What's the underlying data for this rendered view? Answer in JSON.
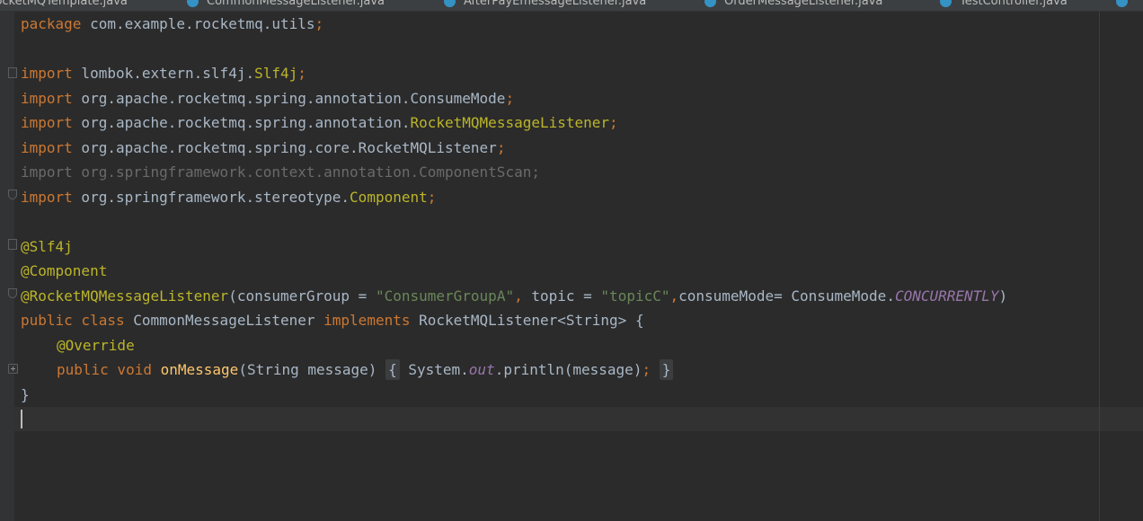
{
  "tabs": [
    {
      "label": "RocketMQTemplate.java"
    },
    {
      "label": "CommonMessageListener.java"
    },
    {
      "label": "AfterPayEmessageListener.java"
    },
    {
      "label": "OrderMessageListener.java"
    },
    {
      "label": "TestController.java"
    }
  ],
  "code": {
    "package_kw": "package",
    "package_name": " com.example.rocketmq.utils",
    "semicolon": ";",
    "import_kw": "import",
    "imports": [
      {
        "path": " lombok.extern.slf4j.",
        "cls": "Slf4j"
      },
      {
        "path": " org.apache.rocketmq.spring.annotation.ConsumeMode",
        "cls": ""
      },
      {
        "path": " org.apache.rocketmq.spring.annotation.",
        "cls": "RocketMQMessageListener"
      },
      {
        "path": " org.apache.rocketmq.spring.core.RocketMQListener",
        "cls": ""
      },
      {
        "path": " org.springframework.context.annotation.ComponentScan;",
        "cls": ""
      },
      {
        "path": " org.springframework.stereotype.",
        "cls": "Component"
      }
    ],
    "ann_slf4j": "@Slf4j",
    "ann_component": "@Component",
    "ann_listener": "@RocketMQMessageListener",
    "listener_args_open": "(consumerGroup = ",
    "consumer_group": "\"ConsumerGroupA\"",
    "comma": ",",
    "topic_label": " topic = ",
    "topic_value": "\"topicC\"",
    "consume_mode_label": "consumeMode= ConsumeMode.",
    "consume_mode_value": "CONCURRENTLY",
    "close_paren": ")",
    "public_kw": "public",
    "class_kw": " class",
    "class_name": " CommonMessageListener",
    "implements_kw": " implements",
    "implements_type": " RocketMQListener<String> {",
    "override": "@Override",
    "void_kw": " void",
    "method_name": "onMessage",
    "method_params": "(String message) ",
    "brace_open": "{",
    "body_prefix": " System.",
    "out_field": "out",
    "body_suffix": ".println(message)",
    "brace_close": "}",
    "class_close": "}"
  }
}
